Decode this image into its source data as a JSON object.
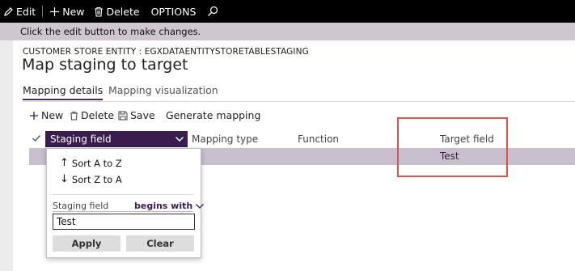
{
  "toolbar": {
    "edit_label": "Edit",
    "new_label": "New",
    "delete_label": "Delete",
    "options_label": "OPTIONS"
  },
  "info_message": "Click the edit button to make changes.",
  "header": {
    "entity_caption": "CUSTOMER STORE ENTITY : EGXDATAENTITYSTORETABLESTAGING",
    "page_title": "Map staging to target"
  },
  "tabs": [
    {
      "label": "Mapping details",
      "active": true
    },
    {
      "label": "Mapping visualization",
      "active": false
    }
  ],
  "actions": {
    "new_label": "New",
    "delete_label": "Delete",
    "save_label": "Save",
    "generate_label": "Generate mapping"
  },
  "grid": {
    "columns": [
      "Staging field",
      "Mapping type",
      "Function",
      "Target field"
    ],
    "rows": [
      {
        "staging_field": "",
        "mapping_type": "",
        "function": "",
        "target_field": "Test"
      }
    ]
  },
  "filter_dropdown": {
    "sort_asc_label": "Sort A to Z",
    "sort_desc_label": "Sort Z to A",
    "field_label": "Staging field",
    "operator_label": "begins with",
    "filter_value": "Test",
    "apply_label": "Apply",
    "clear_label": "Clear"
  },
  "colors": {
    "accent": "#3a1d4f",
    "info_bar": "#cfc6d1",
    "selected_row": "#c8bfcc",
    "highlight_box": "#d9534f"
  }
}
